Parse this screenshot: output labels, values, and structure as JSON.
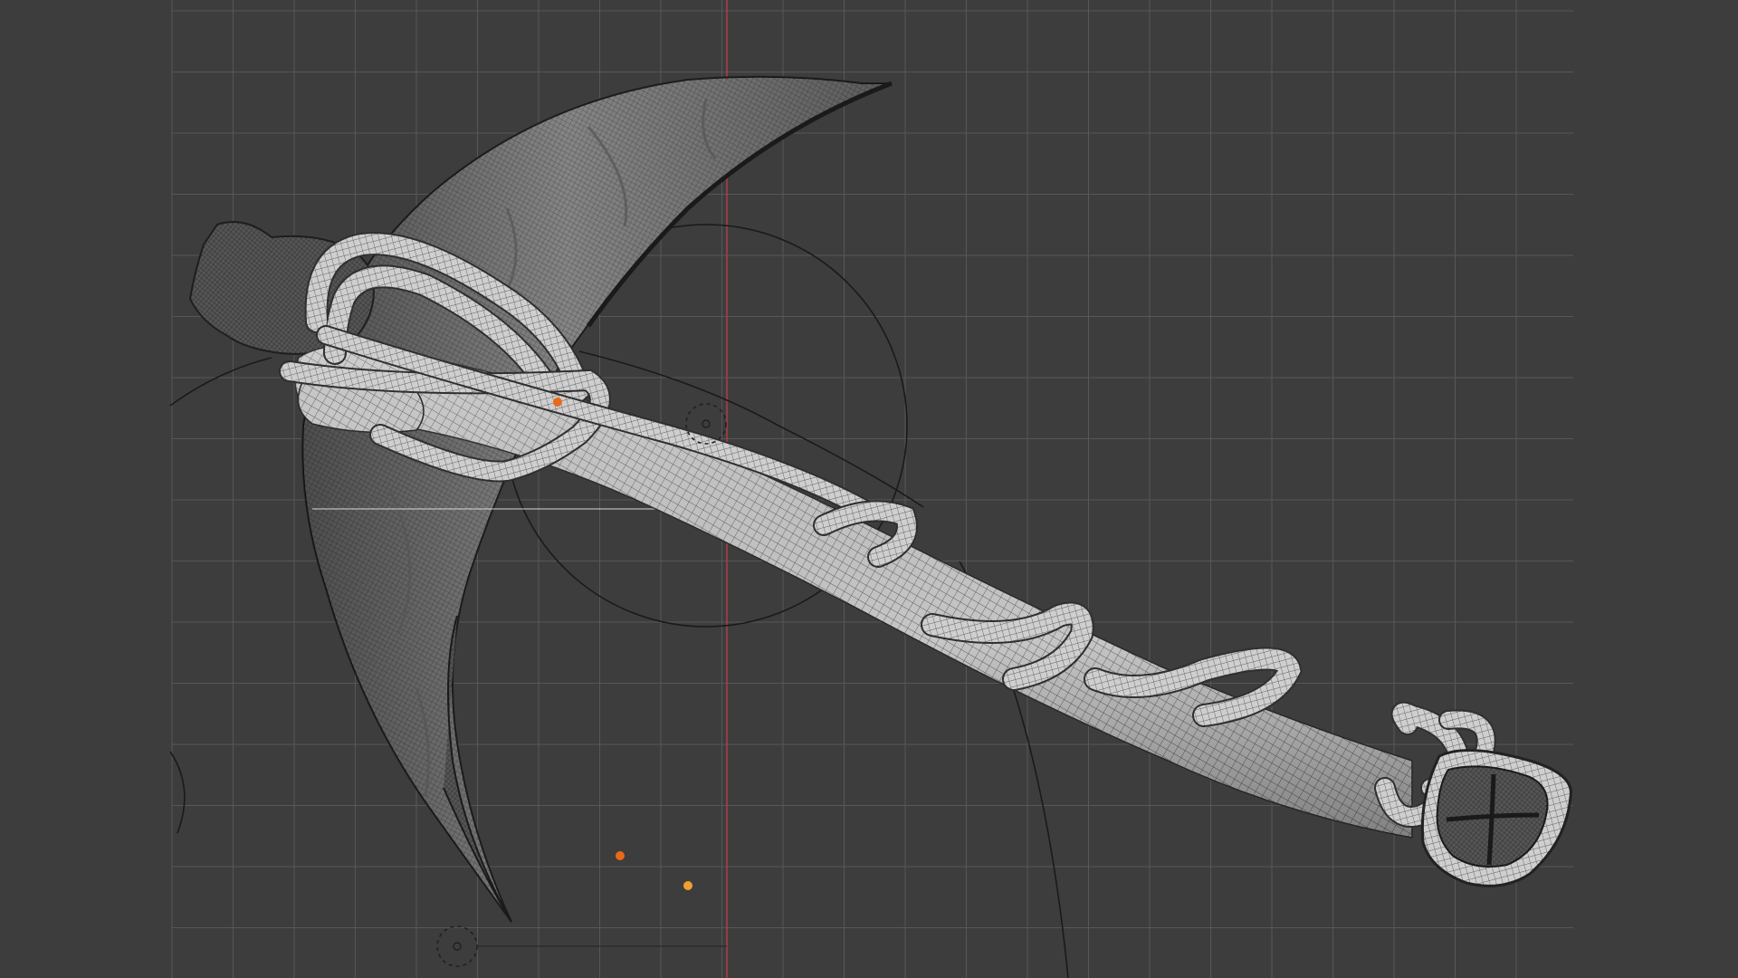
{
  "viewport": {
    "background_color": "#3d3d3d",
    "grid_line_color": "#575757",
    "grid_edge_color": "#363636",
    "axis_color": "#b43d45",
    "curve_color": "#1a1a1a",
    "selected_point_color": "#e86a1a",
    "point_color": "#f0a030"
  },
  "model": {
    "mesh_base_color": "#8a8a8a",
    "mesh_dark_color": "#3a3a3a",
    "rope_color": "#c4c4c4",
    "rope_wire_color": "#5a5a5a"
  },
  "icons": {
    "empty_icon": "empty-object-icon",
    "point_icon": "vertex-point-icon"
  }
}
